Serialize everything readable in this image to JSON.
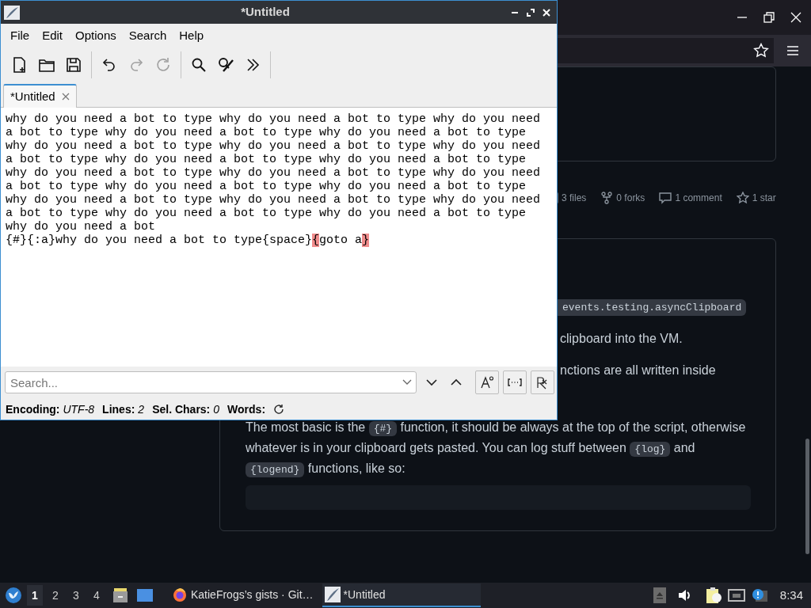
{
  "browser": {
    "bookmark_star": true,
    "gist_stats": [
      {
        "kind": "files",
        "label": "3 files"
      },
      {
        "kind": "forks",
        "label": "0 forks"
      },
      {
        "kind": "comments",
        "label": "1 comment"
      },
      {
        "kind": "stars",
        "label": "1 star"
      }
    ],
    "content": [
      {
        "kind": "code",
        "text": "events.testing.asyncClipboard"
      },
      {
        "kind": "text",
        "text": "clipboard into the VM."
      },
      {
        "kind": "text",
        "text": "nctions are all written inside"
      },
      {
        "kind": "paragraph",
        "segments": [
          {
            "code": false,
            "text": "The most basic is the "
          },
          {
            "code": true,
            "text": "{#}"
          },
          {
            "code": false,
            "text": " function, it should be always at the top of the script, otherwise whatever is in your clipboard gets pasted. You can log stuff between "
          },
          {
            "code": true,
            "text": "{log}"
          },
          {
            "code": false,
            "text": " and "
          },
          {
            "code": true,
            "text": "{logend}"
          },
          {
            "code": false,
            "text": " functions, like so:"
          }
        ]
      },
      {
        "kind": "codeblock"
      }
    ]
  },
  "editor": {
    "window": {
      "title": "*Untitled"
    },
    "menu": [
      "File",
      "Edit",
      "Options",
      "Search",
      "Help"
    ],
    "toolbar": [
      {
        "kind": "new",
        "disabled": false
      },
      {
        "kind": "open",
        "disabled": false
      },
      {
        "kind": "save",
        "disabled": false
      },
      {
        "kind": "sep"
      },
      {
        "kind": "undo",
        "disabled": false
      },
      {
        "kind": "redo",
        "disabled": true
      },
      {
        "kind": "reload",
        "disabled": true
      },
      {
        "kind": "sep"
      },
      {
        "kind": "find",
        "disabled": false
      },
      {
        "kind": "replace",
        "disabled": false
      },
      {
        "kind": "more",
        "disabled": false
      },
      {
        "kind": "sep"
      }
    ],
    "tabs": [
      {
        "label": "*Untitled",
        "selected": true
      }
    ],
    "lines": [
      [
        {
          "text": "why do you need a bot to type why do you need a bot to type why do you need a bot to type why do you need a bot to type why do you need a bot to type why do you need a bot to type why do you need a bot to type why do you need a bot to type why do you need a bot to type why do you need a bot to type why do you need a bot to type why do you need a bot to type why do you need a bot to type why do you need a bot to type why do you need a bot to type why do you need a bot to type why do you need a bot to type why do you need a bot to type why do you need a bot to type why do you need a bot to type why do you need a bot",
          "highlight": false
        }
      ],
      [
        {
          "text": "{#}{:a}why do you need a bot to type{space}",
          "highlight": false
        },
        {
          "text": "{",
          "highlight": true
        },
        {
          "text": "goto a",
          "highlight": false
        },
        {
          "text": "}",
          "highlight": true
        }
      ]
    ],
    "search": {
      "placeholder": "Search..."
    },
    "search_options": [
      {
        "kind": "case",
        "on": false
      },
      {
        "kind": "whole",
        "on": false
      },
      {
        "kind": "regex",
        "on": false
      }
    ],
    "status_bar": [
      {
        "label": "Encoding:",
        "value": "UTF-8"
      },
      {
        "label": "Lines:",
        "value": "2"
      },
      {
        "label": "Sel. Chars:",
        "value": "0"
      },
      {
        "label": "Words:"
      }
    ]
  },
  "taskbar": {
    "workspaces": [
      {
        "label": "1",
        "selected": true
      },
      {
        "label": "2",
        "selected": false
      },
      {
        "label": "3",
        "selected": false
      },
      {
        "label": "4",
        "selected": false
      }
    ],
    "tasks": [
      {
        "kind": "browser",
        "label": "KatieFrogs’s gists · Git…",
        "selected": false
      },
      {
        "kind": "editor",
        "label": "*Untitled",
        "selected": true
      }
    ],
    "clock": "8:34"
  }
}
